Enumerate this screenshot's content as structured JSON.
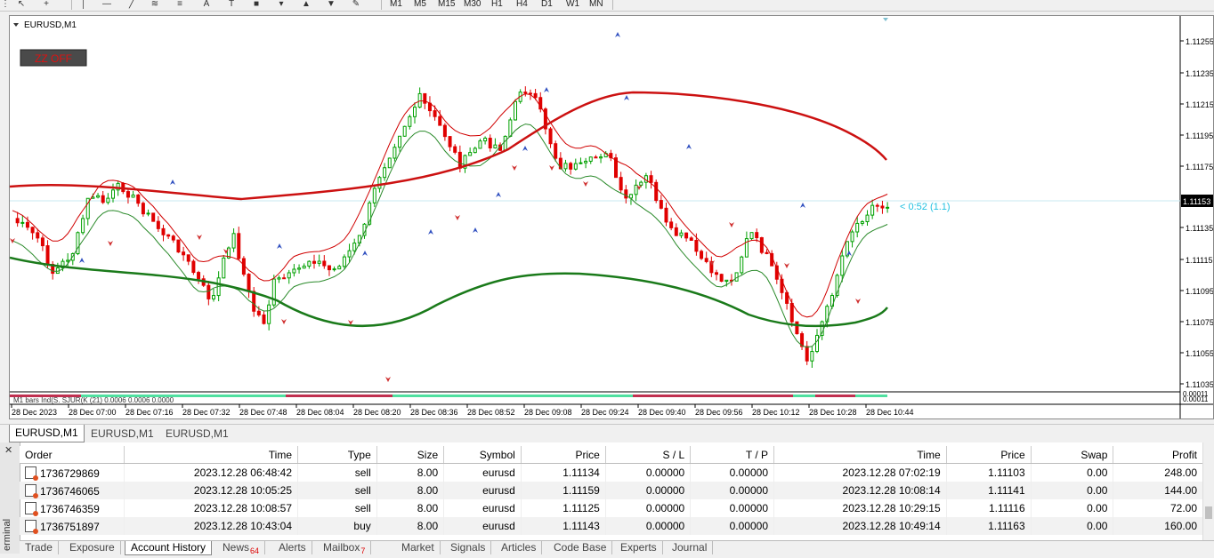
{
  "timeframes": [
    "M1",
    "M5",
    "M15",
    "M30",
    "H1",
    "H4",
    "D1",
    "W1",
    "MN"
  ],
  "chart": {
    "title": "EURUSD,M1",
    "zz_button": "ZZ OFF",
    "timer_label": "< 0:52 (1.1)",
    "current_price": "1.11153",
    "indicator_label": "M1 bars Ind(S. SJUR(K (21) 0.0006 0.0006 0.0000",
    "indicator_value": "0.00011",
    "indicator_value2": "0.00011",
    "y_ticks": [
      "1.11255",
      "1.11235",
      "1.11215",
      "1.11195",
      "1.11175",
      "1.11135",
      "1.11115",
      "1.11095",
      "1.11075",
      "1.11055",
      "1.11035"
    ],
    "x_ticks": [
      "28 Dec 2023",
      "28 Dec 07:00",
      "28 Dec 07:16",
      "28 Dec 07:32",
      "28 Dec 07:48",
      "28 Dec 08:04",
      "28 Dec 08:20",
      "28 Dec 08:36",
      "28 Dec 08:52",
      "28 Dec 09:08",
      "28 Dec 09:24",
      "28 Dec 09:40",
      "28 Dec 09:56",
      "28 Dec 10:12",
      "28 Dec 10:28",
      "28 Dec 10:44"
    ],
    "colors": {
      "bull": "#00a000",
      "bear": "#e00000",
      "ma_red": "#cc1111",
      "ma_green": "#1a7a1a",
      "band_red": "#d00000",
      "band_green": "#2a8a2a",
      "price_line": "#c8e8f0",
      "timer": "#20c0e0"
    }
  },
  "chart_tabs": [
    "EURUSD,M1",
    "EURUSD,M1",
    "EURUSD,M1"
  ],
  "history": {
    "columns": [
      "Order",
      "Time",
      "Type",
      "Size",
      "Symbol",
      "Price",
      "S / L",
      "T / P",
      "Time",
      "Price",
      "Swap",
      "Profit"
    ],
    "rows": [
      [
        "1736729869",
        "2023.12.28 06:48:42",
        "sell",
        "8.00",
        "eurusd",
        "1.11134",
        "0.00000",
        "0.00000",
        "2023.12.28 07:02:19",
        "1.11103",
        "0.00",
        "248.00"
      ],
      [
        "1736746065",
        "2023.12.28 10:05:25",
        "sell",
        "8.00",
        "eurusd",
        "1.11159",
        "0.00000",
        "0.00000",
        "2023.12.28 10:08:14",
        "1.11141",
        "0.00",
        "144.00"
      ],
      [
        "1736746359",
        "2023.12.28 10:08:57",
        "sell",
        "8.00",
        "eurusd",
        "1.11125",
        "0.00000",
        "0.00000",
        "2023.12.28 10:29:15",
        "1.11116",
        "0.00",
        "72.00"
      ],
      [
        "1736751897",
        "2023.12.28 10:43:04",
        "buy",
        "8.00",
        "eurusd",
        "1.11143",
        "0.00000",
        "0.00000",
        "2023.12.28 10:49:14",
        "1.11163",
        "0.00",
        "160.00"
      ]
    ]
  },
  "terminal_label": "erminal",
  "bottom_tabs": [
    {
      "label": "Trade"
    },
    {
      "label": "Exposure"
    },
    {
      "label": "Account History"
    },
    {
      "label": "News",
      "badge": "64"
    },
    {
      "label": "Alerts"
    },
    {
      "label": "Mailbox",
      "badge": "7"
    },
    {
      "label": "Market"
    },
    {
      "label": "Signals"
    },
    {
      "label": "Articles"
    },
    {
      "label": "Code Base"
    },
    {
      "label": "Experts"
    },
    {
      "label": "Journal"
    }
  ]
}
